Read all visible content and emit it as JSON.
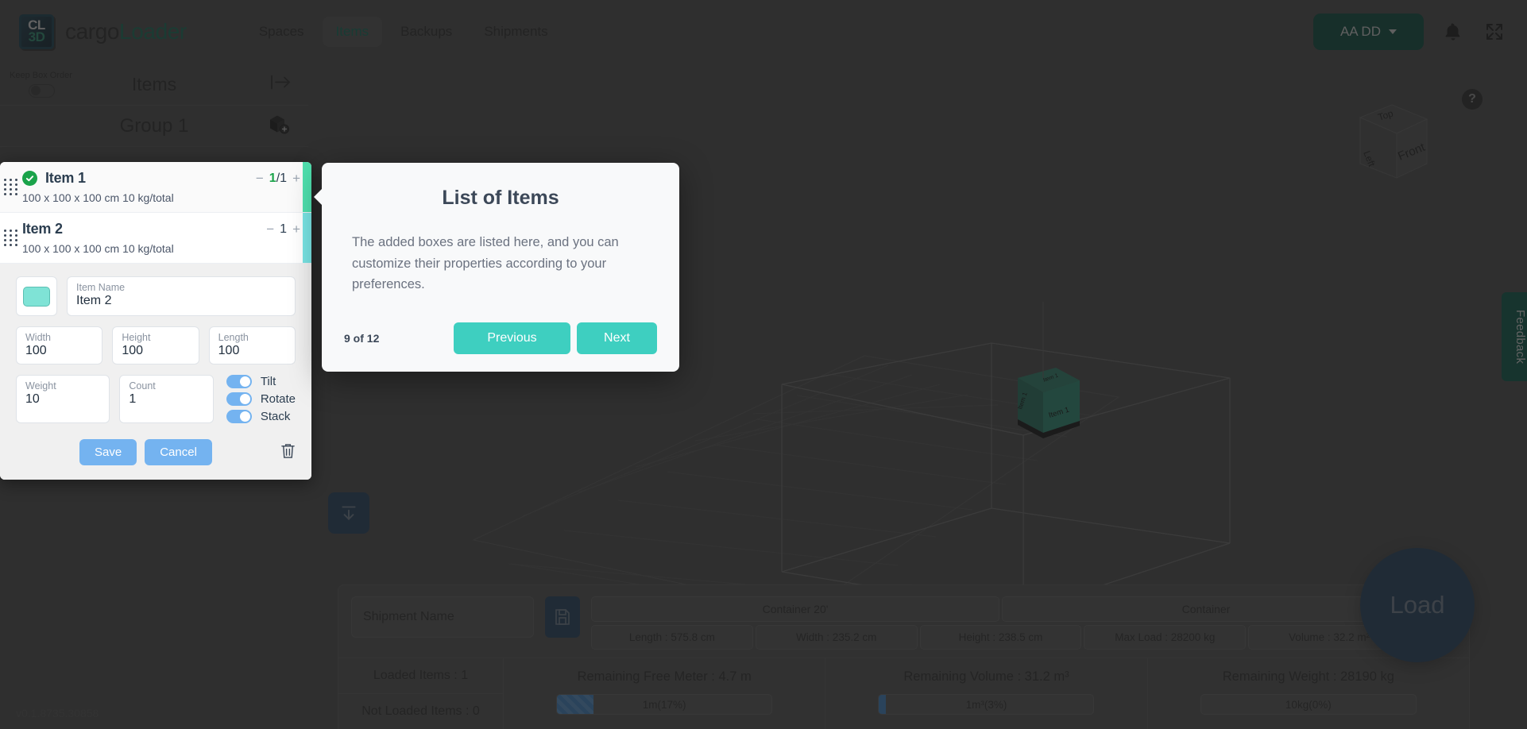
{
  "header": {
    "logo_top": "CL",
    "logo_bottom": "3D",
    "brand_part1": "cargo",
    "brand_part2": "Loader",
    "nav": [
      {
        "label": "Spaces",
        "active": false
      },
      {
        "label": "Items",
        "active": true
      },
      {
        "label": "Backups",
        "active": false
      },
      {
        "label": "Shipments",
        "active": false
      }
    ],
    "user_label": "AA DD",
    "notifications_icon": "bell-icon",
    "fullscreen_icon": "expand-icon"
  },
  "left_panel": {
    "keep_box_order_label": "Keep Box Order",
    "keep_box_order_on": false,
    "title": "Items",
    "collapse_icon": "collapse-panel-icon",
    "group_title": "Group 1",
    "add_box_icon": "add-box-icon",
    "version": "v0.1.8735.30858",
    "items": [
      {
        "name": "Item 1",
        "details": "100 x 100 x 100 cm 10 kg/total",
        "loaded": "1",
        "count": "1",
        "qty_display": "1/1",
        "checked": true,
        "accent": "#4fe0ae"
      },
      {
        "name": "Item 2",
        "details": "100 x 100 x 100 cm 10 kg/total",
        "count": "1",
        "qty_display": "1",
        "checked": false,
        "accent": "#79e4e4"
      }
    ],
    "form": {
      "color_swatch": "#7fe3d6",
      "name_label": "Item Name",
      "name_value": "Item 2",
      "width_label": "Width",
      "width_value": "100",
      "height_label": "Height",
      "height_value": "100",
      "length_label": "Length",
      "length_value": "100",
      "weight_label": "Weight",
      "weight_value": "10",
      "count_label": "Count",
      "count_value": "1",
      "tilt_label": "Tilt",
      "tilt_on": true,
      "rotate_label": "Rotate",
      "rotate_on": true,
      "stack_label": "Stack",
      "stack_on": true,
      "save_label": "Save",
      "cancel_label": "Cancel",
      "delete_icon": "trash-icon"
    }
  },
  "viewport": {
    "help_icon": "?",
    "view_cube": {
      "top": "Top",
      "left": "Left",
      "front": "Front"
    },
    "feedback_label": "Feedback",
    "load_label": "Load",
    "download_icon": "download-icon",
    "box_label": "Item 1"
  },
  "bottom_bar": {
    "shipment_name_placeholder": "Shipment Name",
    "save_icon": "floppy-save-icon",
    "pdf_icon": "pdf-export-icon",
    "container_headers": [
      "Container 20'",
      "Container"
    ],
    "container_dims": [
      "Length : 575.8 cm",
      "Width : 235.2 cm",
      "Height : 238.5 cm",
      "Max Load : 28200 kg",
      "Volume : 32.2 m²"
    ],
    "loaded_items": "Loaded Items : 1",
    "not_loaded_items": "Not Loaded Items : 0",
    "stats": [
      {
        "title": "Remaining Free Meter : 4.7 m",
        "bar_text": "1m(17%)",
        "percent": 17,
        "striped": true
      },
      {
        "title": "Remaining Volume : 31.2 m³",
        "bar_text": "1m³(3%)",
        "percent": 3,
        "striped": false
      },
      {
        "title": "Remaining Weight : 28190 kg",
        "bar_text": "10kg(0%)",
        "percent": 0,
        "striped": false
      }
    ]
  },
  "tour": {
    "title": "List of Items",
    "body": "The added boxes are listed here, and you can customize their properties according to your preferences.",
    "step_label": "9 of 12",
    "previous_label": "Previous",
    "next_label": "Next",
    "accent_color": "#3ecfc0"
  }
}
